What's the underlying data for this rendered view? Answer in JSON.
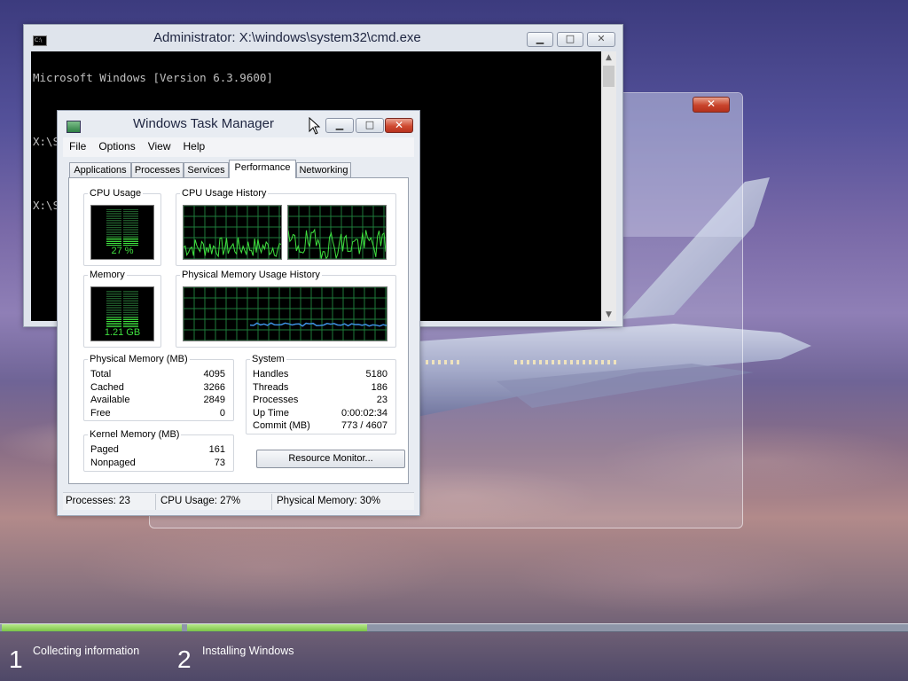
{
  "cmd": {
    "title": "Administrator: X:\\windows\\system32\\cmd.exe",
    "icon_label": "C:\\",
    "lines": [
      "Microsoft Windows [Version 6.3.9600]",
      "",
      "X:\\Sources>taskmgr",
      "",
      "X:\\Sources>_"
    ]
  },
  "setup_window": {
    "close_label": "✕"
  },
  "taskmgr": {
    "title": "Windows Task Manager",
    "menu": [
      "File",
      "Options",
      "View",
      "Help"
    ],
    "tabs": [
      "Applications",
      "Processes",
      "Services",
      "Performance",
      "Networking"
    ],
    "active_tab": "Performance",
    "cpu_usage": {
      "label": "CPU Usage",
      "value": "27 %",
      "percent": 27
    },
    "cpu_history_label": "CPU Usage History",
    "memory": {
      "label": "Memory",
      "value": "1.21 GB",
      "percent": 30
    },
    "memory_history_label": "Physical Memory Usage History",
    "physical_memory": {
      "label": "Physical Memory (MB)",
      "rows": [
        {
          "key": "Total",
          "value": "4095"
        },
        {
          "key": "Cached",
          "value": "3266"
        },
        {
          "key": "Available",
          "value": "2849"
        },
        {
          "key": "Free",
          "value": "0"
        }
      ]
    },
    "kernel_memory": {
      "label": "Kernel Memory (MB)",
      "rows": [
        {
          "key": "Paged",
          "value": "161"
        },
        {
          "key": "Nonpaged",
          "value": "73"
        }
      ]
    },
    "system": {
      "label": "System",
      "rows": [
        {
          "key": "Handles",
          "value": "5180"
        },
        {
          "key": "Threads",
          "value": "186"
        },
        {
          "key": "Processes",
          "value": "23"
        },
        {
          "key": "Up Time",
          "value": "0:00:02:34"
        },
        {
          "key": "Commit (MB)",
          "value": "773 / 4607"
        }
      ]
    },
    "resource_monitor_button": "Resource Monitor...",
    "status": {
      "processes": "Processes: 23",
      "cpu": "CPU Usage: 27%",
      "memory": "Physical Memory: 30%"
    }
  },
  "setup_progress": {
    "steps": [
      {
        "number": "1",
        "label": "Collecting information",
        "progress": 1.0
      },
      {
        "number": "2",
        "label": "Installing Windows",
        "progress": 0.25
      }
    ]
  },
  "colors": {
    "graph_line": "#3fe03f",
    "graph_grid": "#1e7a3a",
    "memory_line": "#3d8fe0",
    "progress_fill": "#7cc447"
  }
}
